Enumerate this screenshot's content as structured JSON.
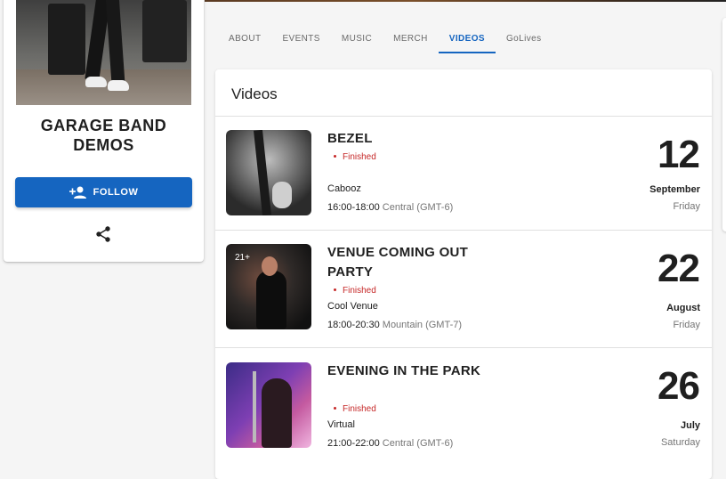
{
  "profile": {
    "band_name": "GARAGE BAND DEMOS",
    "follow_label": "FOLLOW"
  },
  "tabs": [
    {
      "label": "ABOUT",
      "active": false
    },
    {
      "label": "EVENTS",
      "active": false
    },
    {
      "label": "MUSIC",
      "active": false
    },
    {
      "label": "MERCH",
      "active": false
    },
    {
      "label": "VIDEOS",
      "active": true
    },
    {
      "label": "GoLives",
      "active": false
    }
  ],
  "videos": {
    "title": "Videos",
    "events": [
      {
        "title": "BEZEL",
        "status": "Finished",
        "venue": "Cabooz",
        "time": "16:00-18:00",
        "timezone": "Central (GMT-6)",
        "day": "12",
        "month": "September",
        "weekday": "Friday"
      },
      {
        "title": "VENUE COMING OUT PARTY",
        "status": "Finished",
        "venue": "Cool Venue",
        "time": "18:00-20:30",
        "timezone": "Mountain (GMT-7)",
        "day": "22",
        "month": "August",
        "weekday": "Friday",
        "thumb_badge": "21+"
      },
      {
        "title": "EVENING IN THE PARK",
        "status": "Finished",
        "venue": "Virtual",
        "time": "21:00-22:00",
        "timezone": "Central (GMT-6)",
        "day": "26",
        "month": "July",
        "weekday": "Saturday"
      }
    ]
  },
  "colors": {
    "accent": "#1565c0",
    "status_finished": "#c62828",
    "muted_text": "#757575"
  },
  "icons": {
    "follow": "person-add-icon",
    "share": "share-icon"
  }
}
